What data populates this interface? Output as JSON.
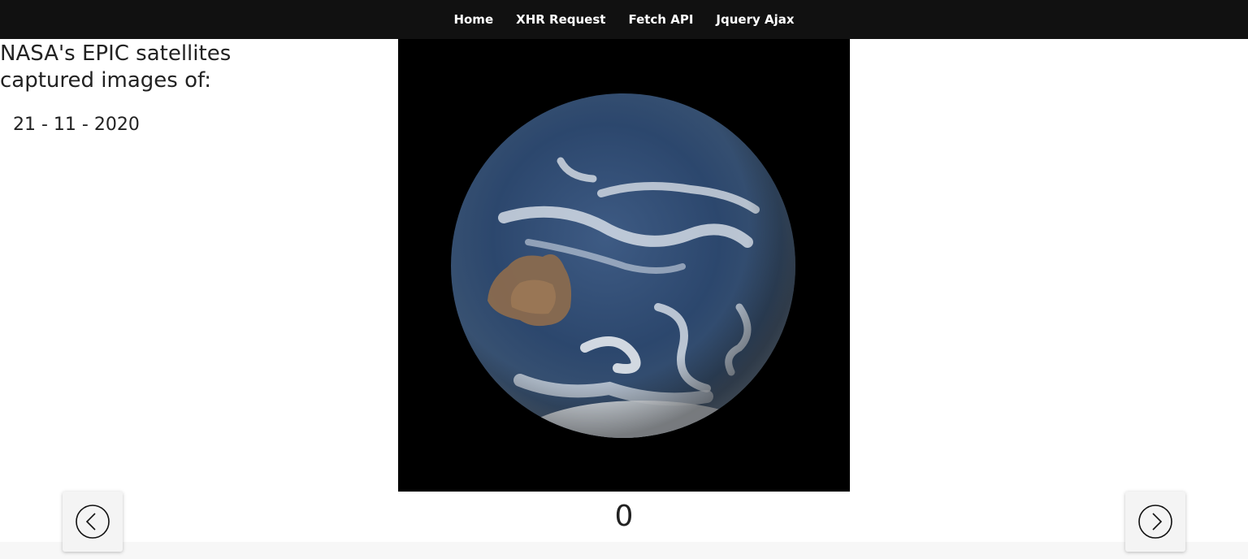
{
  "nav": {
    "items": [
      "Home",
      "XHR Request",
      "Fetch API",
      "Jquery Ajax"
    ]
  },
  "content": {
    "heading": "NASA's EPIC satellites captured images of:",
    "date": "21 - 11 - 2020"
  },
  "viewer": {
    "image_subject": "earth-globe",
    "background_color": "#000000",
    "counter": "0"
  },
  "controls": {
    "prev_icon": "chevron-left-circle-icon",
    "next_icon": "chevron-right-circle-icon"
  },
  "colors": {
    "navbar_bg": "#111111",
    "nav_text": "#ffffff",
    "button_bg": "#f4f4f4"
  }
}
